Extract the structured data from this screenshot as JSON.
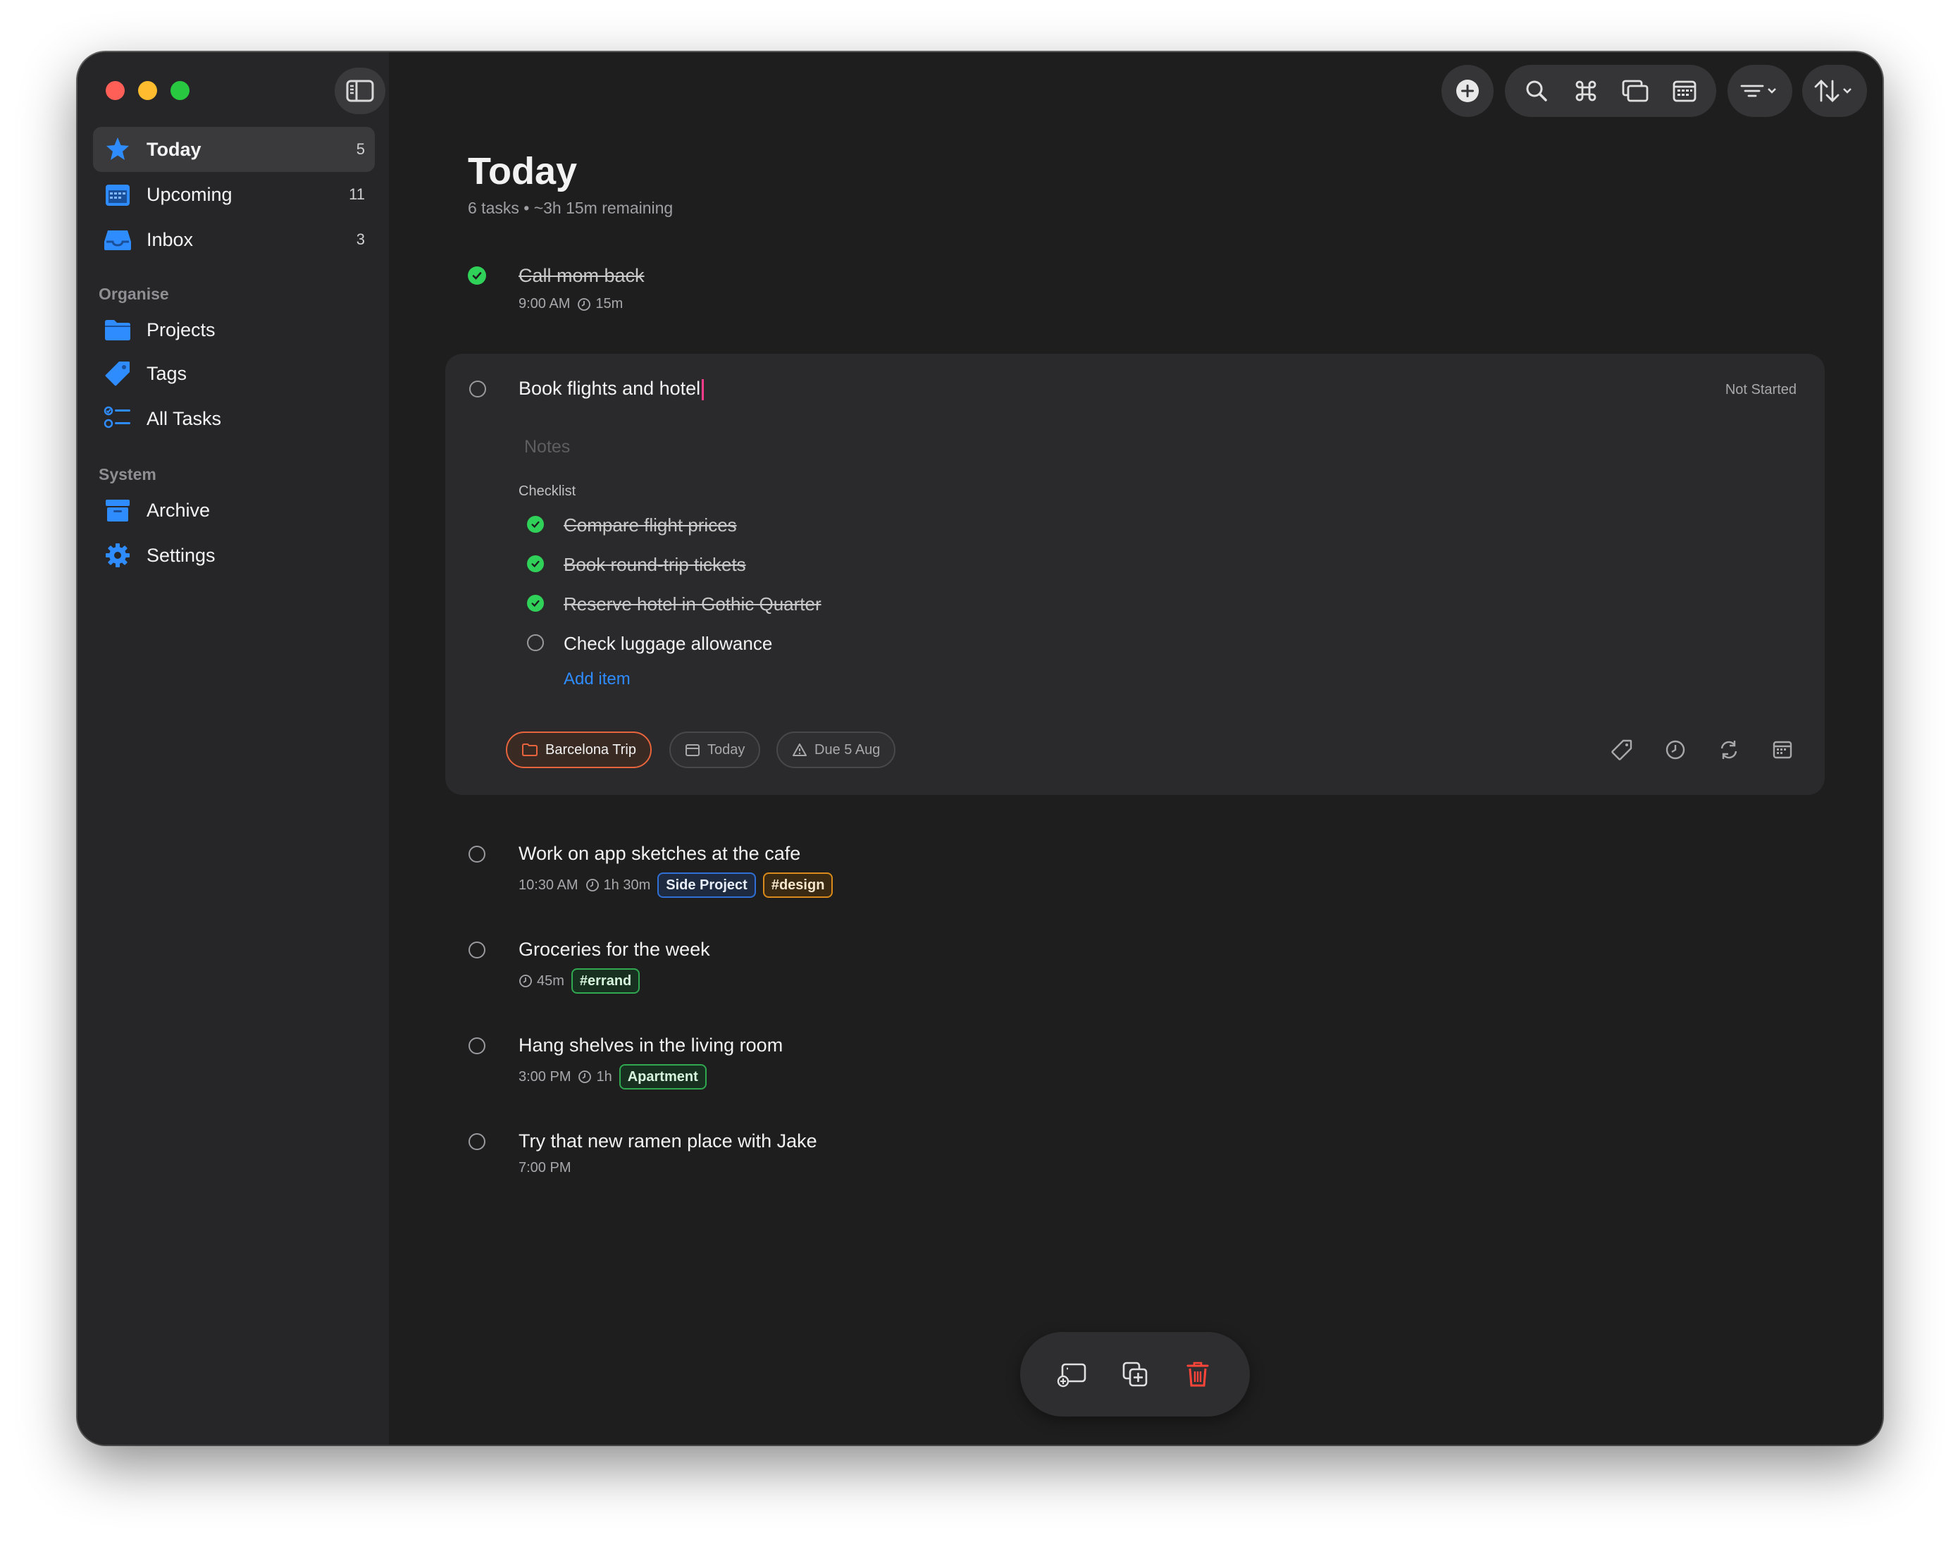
{
  "sidebar": {
    "toggle_icon": "sidebar-toggle-icon",
    "nav": [
      {
        "label": "Today",
        "count": "5",
        "icon": "star-icon"
      },
      {
        "label": "Upcoming",
        "count": "11",
        "icon": "calendar-icon"
      },
      {
        "label": "Inbox",
        "count": "3",
        "icon": "inbox-icon"
      }
    ],
    "organise_label": "Organise",
    "organise": [
      {
        "label": "Projects",
        "icon": "folder-icon"
      },
      {
        "label": "Tags",
        "icon": "tag-icon"
      },
      {
        "label": "All Tasks",
        "icon": "list-icon"
      }
    ],
    "system_label": "System",
    "system": [
      {
        "label": "Archive",
        "icon": "archive-icon"
      },
      {
        "label": "Settings",
        "icon": "gear-icon"
      }
    ]
  },
  "toolbar": {
    "icons": [
      "add-icon",
      "search-icon",
      "command-icon",
      "windows-icon",
      "calendar-grid-icon",
      "filter-icon",
      "sort-icon"
    ]
  },
  "header": {
    "title": "Today",
    "subtitle": "6 tasks • ~3h 15m remaining"
  },
  "tasks": [
    {
      "title": "Call mom back",
      "time": "9:00 AM",
      "duration": "15m",
      "done": true
    },
    {
      "title": "Book flights and hotel",
      "status": "Not Started",
      "notes_placeholder": "Notes",
      "checklist_label": "Checklist",
      "checklist": [
        {
          "label": "Compare flight prices",
          "done": true
        },
        {
          "label": "Book round-trip tickets",
          "done": true
        },
        {
          "label": "Reserve hotel in Gothic Quarter",
          "done": true
        },
        {
          "label": "Check luggage allowance",
          "done": false
        }
      ],
      "add_item": "Add item",
      "project": "Barcelona Trip",
      "when": "Today",
      "due": "Due 5 Aug"
    },
    {
      "title": "Work on app sketches at the cafe",
      "time": "10:30 AM",
      "duration": "1h 30m",
      "tags": [
        "Side Project",
        "#design"
      ]
    },
    {
      "title": "Groceries for the week",
      "duration": "45m",
      "tags": [
        "#errand"
      ]
    },
    {
      "title": "Hang shelves in the living room",
      "time": "3:00 PM",
      "duration": "1h",
      "tags": [
        "Apartment"
      ]
    },
    {
      "title": "Try that new ramen place with Jake",
      "time": "7:00 PM"
    }
  ],
  "colors": {
    "accent_blue": "#2f8cff",
    "check_green": "#30d158",
    "project_orange": "#e8643c",
    "design_orange": "#d98a1a",
    "green_tag": "#2fa84f",
    "delete_red": "#ff453a"
  },
  "bottom_bar": {
    "icons": [
      "add-subtask-icon",
      "duplicate-icon",
      "trash-icon"
    ]
  }
}
